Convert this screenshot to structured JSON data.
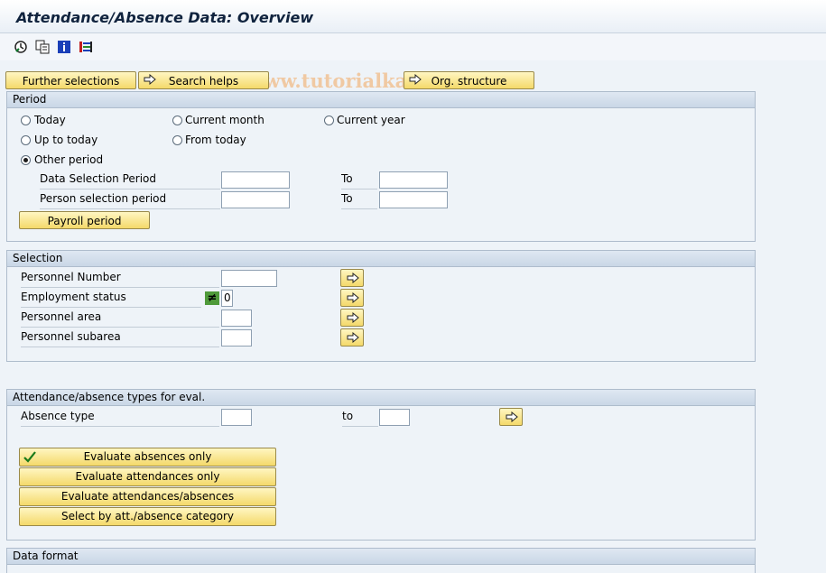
{
  "window": {
    "title": "Attendance/Absence Data: Overview"
  },
  "toolbar": {
    "icons": [
      "execute-icon",
      "copy-variant-icon",
      "info-icon",
      "selection-options-icon"
    ]
  },
  "watermark": "© www.tutorialkart.com",
  "top_buttons": {
    "further_selections": "Further selections",
    "search_helps": "Search helps",
    "org_structure": "Org. structure"
  },
  "period": {
    "header": "Period",
    "today": "Today",
    "current_month": "Current month",
    "current_year": "Current year",
    "up_to_today": "Up to today",
    "from_today": "From today",
    "other_period": "Other period",
    "selected": "Other period",
    "data_selection_label": "Data Selection Period",
    "person_selection_label": "Person selection period",
    "to_label": "To",
    "payroll_period": "Payroll period"
  },
  "selection": {
    "header": "Selection",
    "personnel_number": "Personnel Number",
    "employment_status": "Employment status",
    "employment_status_value": "0",
    "personnel_area": "Personnel area",
    "personnel_subarea": "Personnel subarea"
  },
  "attendance": {
    "header": "Attendance/absence types for eval.",
    "absence_type": "Absence type",
    "to_label": "to",
    "evaluate_absences_only": "Evaluate absences only",
    "evaluate_attendances_only": "Evaluate attendances only",
    "evaluate_att_abs": "Evaluate attendances/absences",
    "select_by_category": "Select by att./absence category"
  },
  "data_format": {
    "header": "Data format"
  }
}
